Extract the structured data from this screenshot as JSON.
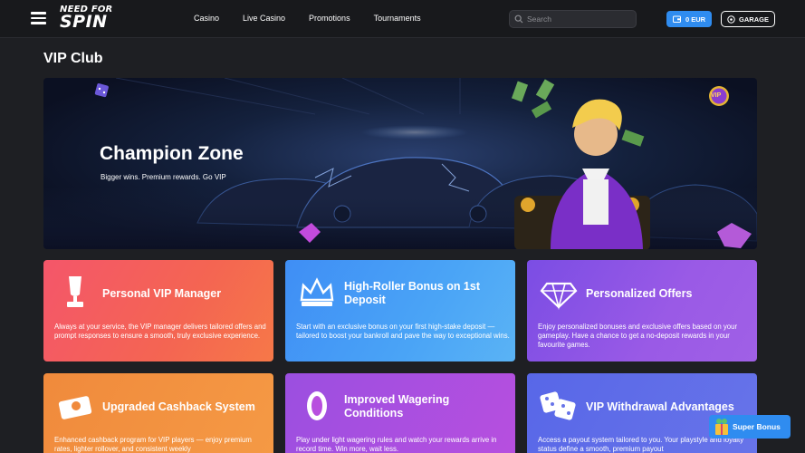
{
  "header": {
    "logo_line1": "NEED FOR",
    "logo_line2": "SPIN",
    "nav": [
      "Casino",
      "Live Casino",
      "Promotions",
      "Tournaments"
    ],
    "search_placeholder": "Search",
    "balance": "0 EUR",
    "garage": "GARAGE"
  },
  "page": {
    "title": "VIP Club"
  },
  "banner": {
    "title": "Champion Zone",
    "subtitle": "Bigger wins. Premium rewards. Go VIP",
    "badge": "VIP"
  },
  "cards": [
    {
      "title": "Personal VIP Manager",
      "desc": "Always at your service, the VIP manager delivers tailored offers and prompt responses to ensure a smooth, truly exclusive experience.",
      "icon": "trophy-icon"
    },
    {
      "title": "High-Roller Bonus on 1st Deposit",
      "desc": "Start with an exclusive bonus on your first high-stake deposit — tailored to boost your bankroll and pave the way to exceptional wins.",
      "icon": "crown-icon"
    },
    {
      "title": "Personalized Offers",
      "desc": "Enjoy personalized bonuses and exclusive offers based on your gameplay. Have a chance to get a no-deposit rewards in your favourite games.",
      "icon": "diamond-icon"
    },
    {
      "title": "Upgraded Cashback System",
      "desc": "Enhanced cashback program for VIP players — enjoy premium rates, lighter rollover, and consistent weekly",
      "icon": "cashback-icon"
    },
    {
      "title": "Improved Wagering Conditions",
      "desc": "Play under light wagering rules and watch your rewards arrive in record time. Win more, wait less.",
      "icon": "coin-icon"
    },
    {
      "title": "VIP Withdrawal Advantages",
      "desc": "Access a payout system tailored to you. Your playstyle and loyalty status define a smooth, premium payout",
      "icon": "dice-icon"
    }
  ],
  "super_bonus": "Super Bonus",
  "colors": {
    "accent": "#2f8cf0",
    "background": "#1e1f23"
  }
}
